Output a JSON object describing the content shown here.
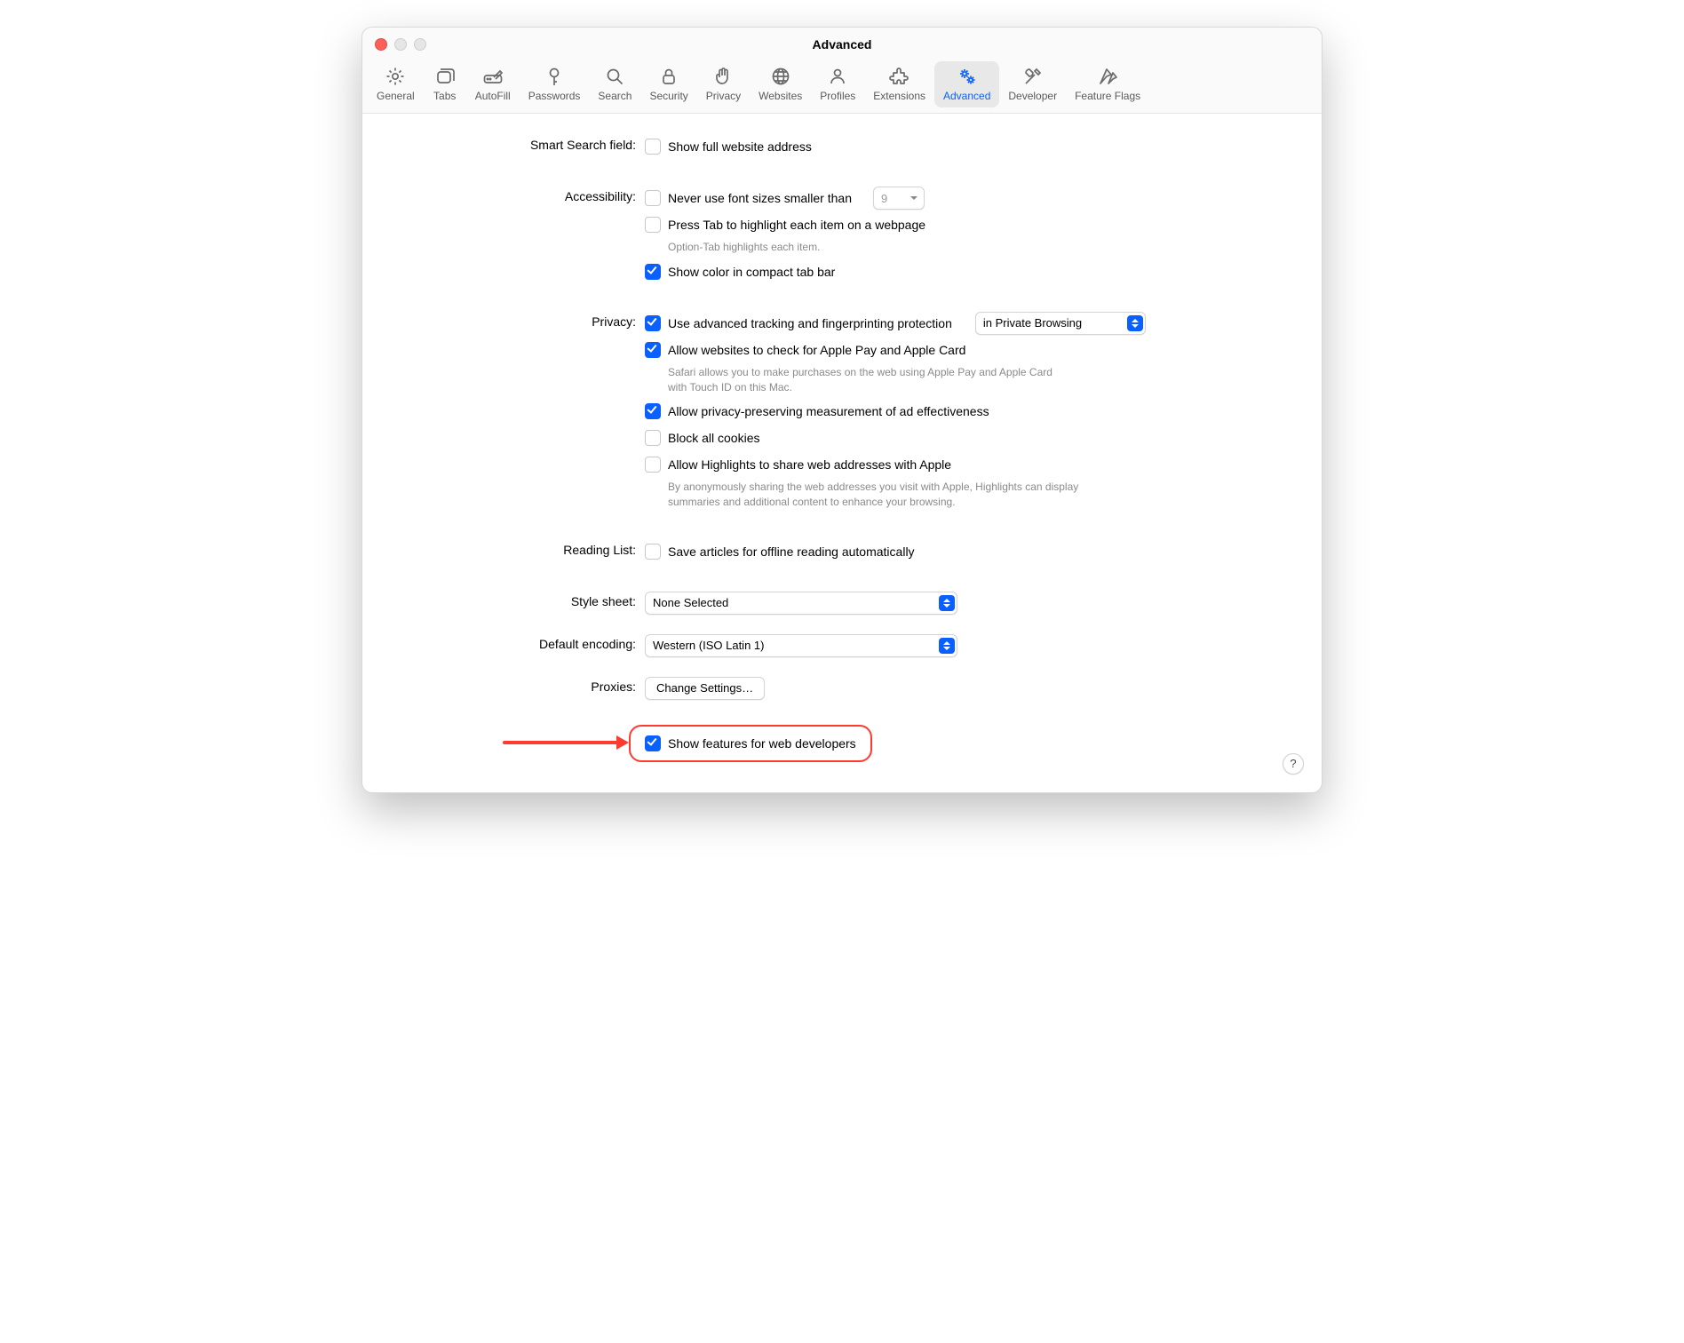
{
  "window": {
    "title": "Advanced"
  },
  "toolbar": {
    "items": [
      {
        "label": "General",
        "icon": "gear"
      },
      {
        "label": "Tabs",
        "icon": "window-stack"
      },
      {
        "label": "AutoFill",
        "icon": "pencil-field"
      },
      {
        "label": "Passwords",
        "icon": "key"
      },
      {
        "label": "Search",
        "icon": "magnifier"
      },
      {
        "label": "Security",
        "icon": "lock"
      },
      {
        "label": "Privacy",
        "icon": "hand"
      },
      {
        "label": "Websites",
        "icon": "globe"
      },
      {
        "label": "Profiles",
        "icon": "person"
      },
      {
        "label": "Extensions",
        "icon": "puzzle"
      },
      {
        "label": "Advanced",
        "icon": "double-gear",
        "active": true
      },
      {
        "label": "Developer",
        "icon": "wrench-screwdriver"
      },
      {
        "label": "Feature Flags",
        "icon": "flags"
      }
    ]
  },
  "sections": {
    "smart_search": {
      "label": "Smart Search field:",
      "show_full_address": {
        "checked": false,
        "label": "Show full website address"
      }
    },
    "accessibility": {
      "label": "Accessibility:",
      "min_font": {
        "checked": false,
        "label": "Never use font sizes smaller than",
        "value": "9"
      },
      "press_tab": {
        "checked": false,
        "label": "Press Tab to highlight each item on a webpage",
        "hint": "Option-Tab highlights each item."
      },
      "show_color_compact": {
        "checked": true,
        "label": "Show color in compact tab bar"
      }
    },
    "privacy": {
      "label": "Privacy:",
      "tracking": {
        "checked": true,
        "label": "Use advanced tracking and fingerprinting protection",
        "mode": "in Private Browsing"
      },
      "apple_pay": {
        "checked": true,
        "label": "Allow websites to check for Apple Pay and Apple Card",
        "hint": "Safari allows you to make purchases on the web using Apple Pay and Apple Card with Touch ID on this Mac."
      },
      "ad_measure": {
        "checked": true,
        "label": "Allow privacy-preserving measurement of ad effectiveness"
      },
      "block_cookies": {
        "checked": false,
        "label": "Block all cookies"
      },
      "highlights": {
        "checked": false,
        "label": "Allow Highlights to share web addresses with Apple",
        "hint": "By anonymously sharing the web addresses you visit with Apple, Highlights can display summaries and additional content to enhance your browsing."
      }
    },
    "reading_list": {
      "label": "Reading List:",
      "save_offline": {
        "checked": false,
        "label": "Save articles for offline reading automatically"
      }
    },
    "style_sheet": {
      "label": "Style sheet:",
      "value": "None Selected"
    },
    "default_encoding": {
      "label": "Default encoding:",
      "value": "Western (ISO Latin 1)"
    },
    "proxies": {
      "label": "Proxies:",
      "button": "Change Settings…"
    },
    "developer": {
      "show_features": {
        "checked": true,
        "label": "Show features for web developers"
      }
    }
  },
  "help": {
    "label": "?"
  }
}
